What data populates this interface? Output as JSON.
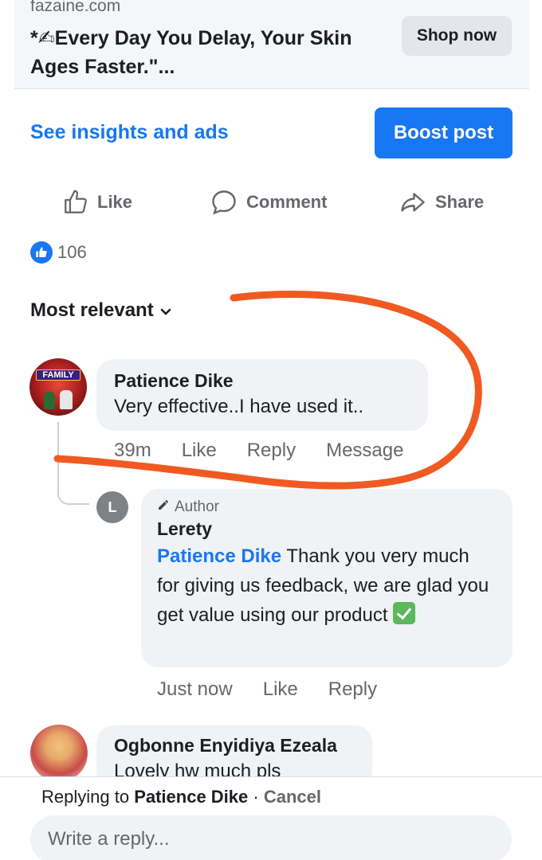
{
  "ad": {
    "domain": "fazaine.com",
    "headline": "*✍Every Day You Delay, Your Skin Ages Faster.\"...",
    "cta": "Shop now"
  },
  "post_actions": {
    "insights_link": "See insights and ads",
    "boost_button": "Boost post",
    "like": "Like",
    "comment": "Comment",
    "share": "Share"
  },
  "reactions": {
    "count": "106",
    "icon": "thumbs-up-icon"
  },
  "sort": {
    "label": "Most relevant",
    "icon": "chevron-down-icon"
  },
  "comments": [
    {
      "author": "Patience Dike",
      "text": "Very effective..I have used it..",
      "time": "39m",
      "actions": [
        "Like",
        "Reply",
        "Message"
      ],
      "reply": {
        "author_badge": "Author",
        "author": "Lerety",
        "avatar_letter": "L",
        "mention": "Patience Dike",
        "text": " Thank you very much for giving us feedback, we are glad you get value using our product",
        "time": "Just now",
        "actions": [
          "Like",
          "Reply"
        ]
      }
    },
    {
      "author": "Ogbonne Enyidiya Ezeala",
      "text": "Lovely hw much pls"
    }
  ],
  "reply_bar": {
    "prefix": "Replying to ",
    "target": "Patience Dike",
    "separator": " · ",
    "cancel": "Cancel",
    "placeholder": "Write a reply..."
  },
  "colors": {
    "accent": "#1877f2",
    "secondary_text": "#65676b",
    "bubble": "#f0f2f5",
    "annotation": "#f05a22"
  }
}
